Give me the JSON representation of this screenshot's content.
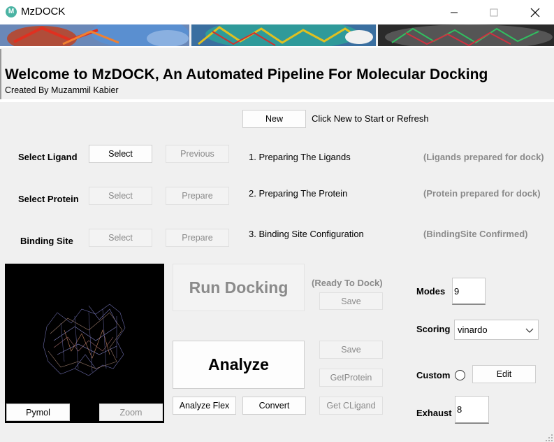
{
  "window": {
    "title": "MzDOCK",
    "app_icon_letter": "M"
  },
  "header": {
    "title": "Welcome to MzDOCK, An Automated Pipeline For Molecular Docking",
    "subtitle": "Created By Muzammil Kabier"
  },
  "new_section": {
    "new_label": "New",
    "hint": "Click New to Start or Refresh"
  },
  "steps": [
    {
      "label": "Select Ligand",
      "select_label": "Select",
      "action_label": "Previous",
      "step_text": "1. Preparing The Ligands",
      "status": "(Ligands prepared for dock)"
    },
    {
      "label": "Select Protein",
      "select_label": "Select",
      "action_label": "Prepare",
      "step_text": "2. Preparing The Protein",
      "status": "(Protein prepared for dock)"
    },
    {
      "label": "Binding Site",
      "select_label": "Select",
      "action_label": "Prepare",
      "step_text": "3. Binding Site Configuration",
      "status": "(BindingSite Confirmed)"
    }
  ],
  "viewer": {
    "pymol_label": "Pymol",
    "zoom_label": "Zoom"
  },
  "docking": {
    "run_label": "Run Docking",
    "status": "(Ready To Dock)",
    "save_label": "Save"
  },
  "analysis": {
    "analyze_label": "Analyze",
    "analyze_flex_label": "Analyze Flex",
    "convert_label": "Convert",
    "save_label": "Save",
    "get_protein_label": "GetProtein",
    "get_cligand_label": "Get CLigand"
  },
  "settings": {
    "modes_label": "Modes",
    "modes_value": "9",
    "scoring_label": "Scoring",
    "scoring_value": "vinardo",
    "custom_label": "Custom",
    "edit_label": "Edit",
    "exhaust_label": "Exhaust",
    "exhaust_value": "8"
  },
  "icons": {
    "minimize": "minimize-icon",
    "maximize": "maximize-icon",
    "close": "close-icon",
    "dropdown": "chevron-down-icon",
    "resize": "resize-grip-icon"
  }
}
